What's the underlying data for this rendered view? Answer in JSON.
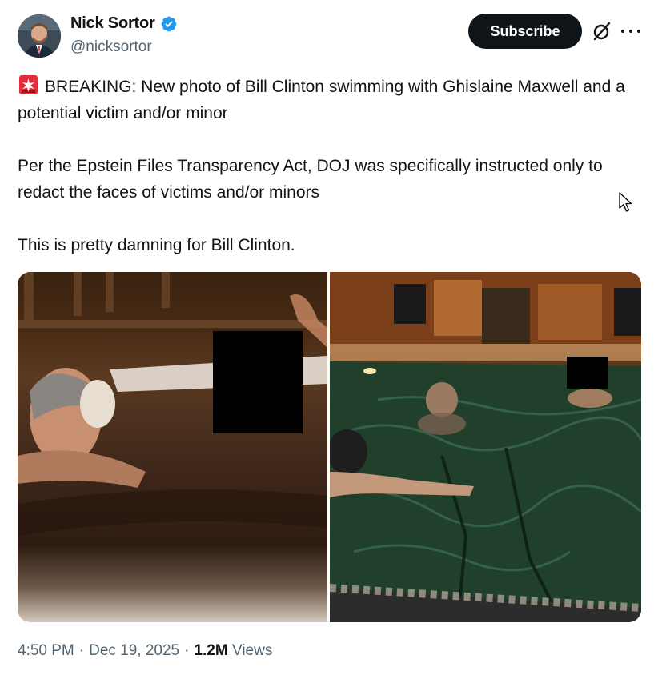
{
  "author": {
    "display_name": "Nick Sortor",
    "handle": "@nicksortor",
    "verified_icon": "verified-badge-icon",
    "avatar": "avatar"
  },
  "actions": {
    "subscribe_label": "Subscribe",
    "grok_icon": "grok-icon",
    "more_icon": "more-options-icon"
  },
  "tweet": {
    "emoji_icon": "rotating-light-siren-icon",
    "text": "BREAKING: New photo of Bill Clinton swimming with Ghislaine Maxwell and a potential victim and/or minor\n\nPer the Epstein Files Transparency Act, DOJ was specifically instructed only to redact the faces of victims and/or minors\n\nThis is pretty damning for Bill Clinton."
  },
  "media": {
    "photos": [
      "photo-hot-tub-redacted",
      "photo-pool-redacted"
    ]
  },
  "meta": {
    "time": "4:50 PM",
    "sep1": "·",
    "date": "Dec 19, 2025",
    "sep2": "·",
    "views_count": "1.2M",
    "views_label": "Views"
  },
  "colors": {
    "text": "#0f1419",
    "secondary": "#536471",
    "verified": "#1d9bf0",
    "subscribe_bg": "#0f1419"
  }
}
